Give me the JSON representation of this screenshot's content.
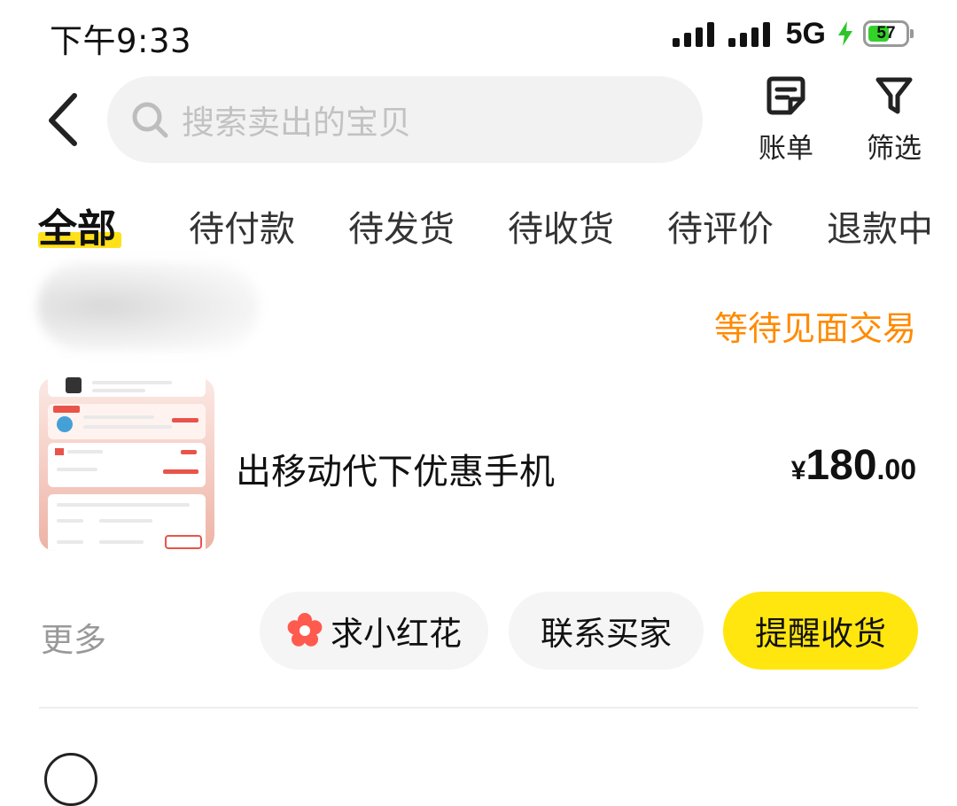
{
  "status_bar": {
    "time": "下午9:33",
    "network": "5G",
    "battery": "57"
  },
  "search": {
    "placeholder": "搜索卖出的宝贝"
  },
  "header": {
    "bill_label": "账单",
    "filter_label": "筛选"
  },
  "tabs": [
    {
      "label": "全部",
      "active": true
    },
    {
      "label": "待付款"
    },
    {
      "label": "待发货"
    },
    {
      "label": "待收货"
    },
    {
      "label": "待评价"
    },
    {
      "label": "退款中"
    }
  ],
  "order": {
    "status": "等待见面交易",
    "title": "出移动代下优惠手机",
    "price": {
      "currency": "¥",
      "integer": "180",
      "decimal": ".00"
    },
    "more_label": "更多",
    "actions": {
      "flower": "求小红花",
      "contact": "联系买家",
      "remind": "提醒收货"
    }
  },
  "colors": {
    "accent_yellow": "#ffe60f",
    "status_orange": "#ff8a00",
    "flower_red": "#ff5a4e"
  }
}
